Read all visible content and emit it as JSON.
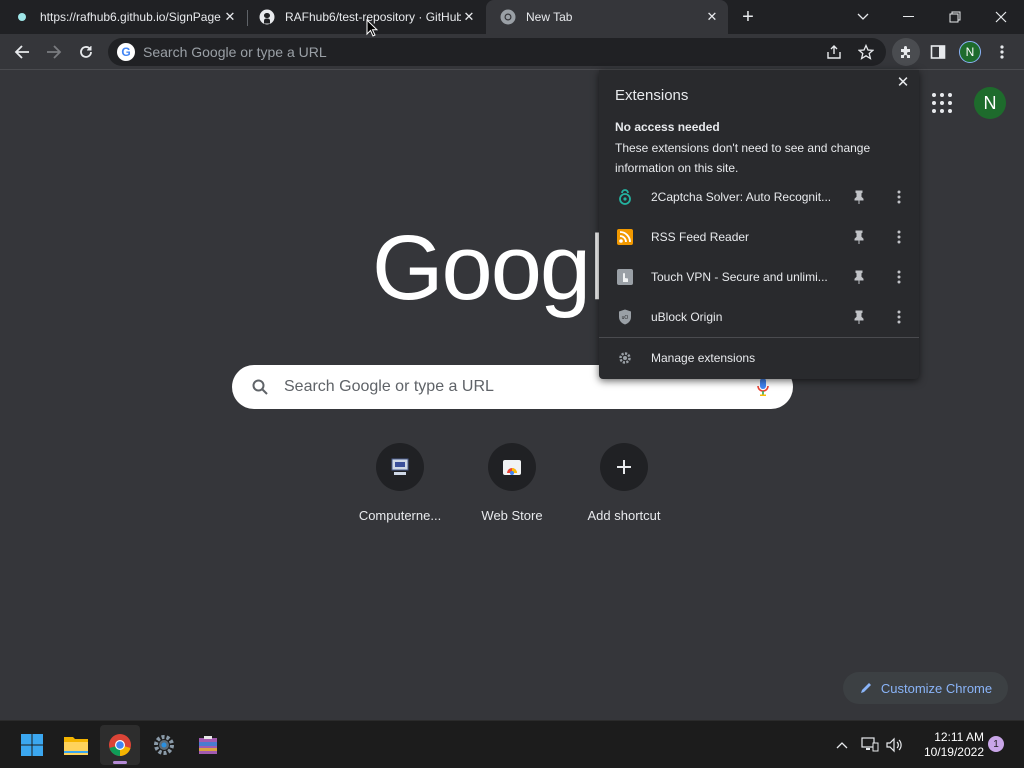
{
  "tabs": [
    {
      "title": "https://rafhub6.github.io/SignPage",
      "icon": "site-favicon",
      "active": false
    },
    {
      "title": "RAFhub6/test-repository · GitHub",
      "icon": "github-icon",
      "active": false
    },
    {
      "title": "New Tab",
      "icon": "chrome-icon",
      "active": true
    }
  ],
  "omnibox": {
    "placeholder": "Search Google or type a URL"
  },
  "profile": {
    "initial": "N",
    "color": "#1e6b2c"
  },
  "ntp": {
    "logo_text": "Google",
    "search_placeholder": "Search Google or type a URL",
    "shortcuts": [
      {
        "label": "Computerne...",
        "icon": "computer-icon"
      },
      {
        "label": "Web Store",
        "icon": "webstore-icon"
      },
      {
        "label": "Add shortcut",
        "icon": "plus-icon"
      }
    ],
    "customize_label": "Customize Chrome"
  },
  "extensions_popup": {
    "title": "Extensions",
    "section_title": "No access needed",
    "section_desc": "These extensions don't need to see and change information on this site.",
    "items": [
      {
        "name": "2Captcha Solver: Auto Recognit...",
        "icon": "captcha-icon"
      },
      {
        "name": "RSS Feed Reader",
        "icon": "rss-icon"
      },
      {
        "name": "Touch VPN - Secure and unlimi...",
        "icon": "vpn-icon"
      },
      {
        "name": "uBlock Origin",
        "icon": "ublock-icon"
      }
    ],
    "manage_label": "Manage extensions"
  },
  "taskbar": {
    "apps": [
      "windows-start",
      "file-explorer",
      "chrome",
      "settings",
      "winrar"
    ],
    "time": "12:11 AM",
    "date": "10/19/2022",
    "notification_count": "1"
  },
  "colors": {
    "accent": "#8ab4f8",
    "profile_bg": "#1e6b2c",
    "background": "#35363a"
  }
}
